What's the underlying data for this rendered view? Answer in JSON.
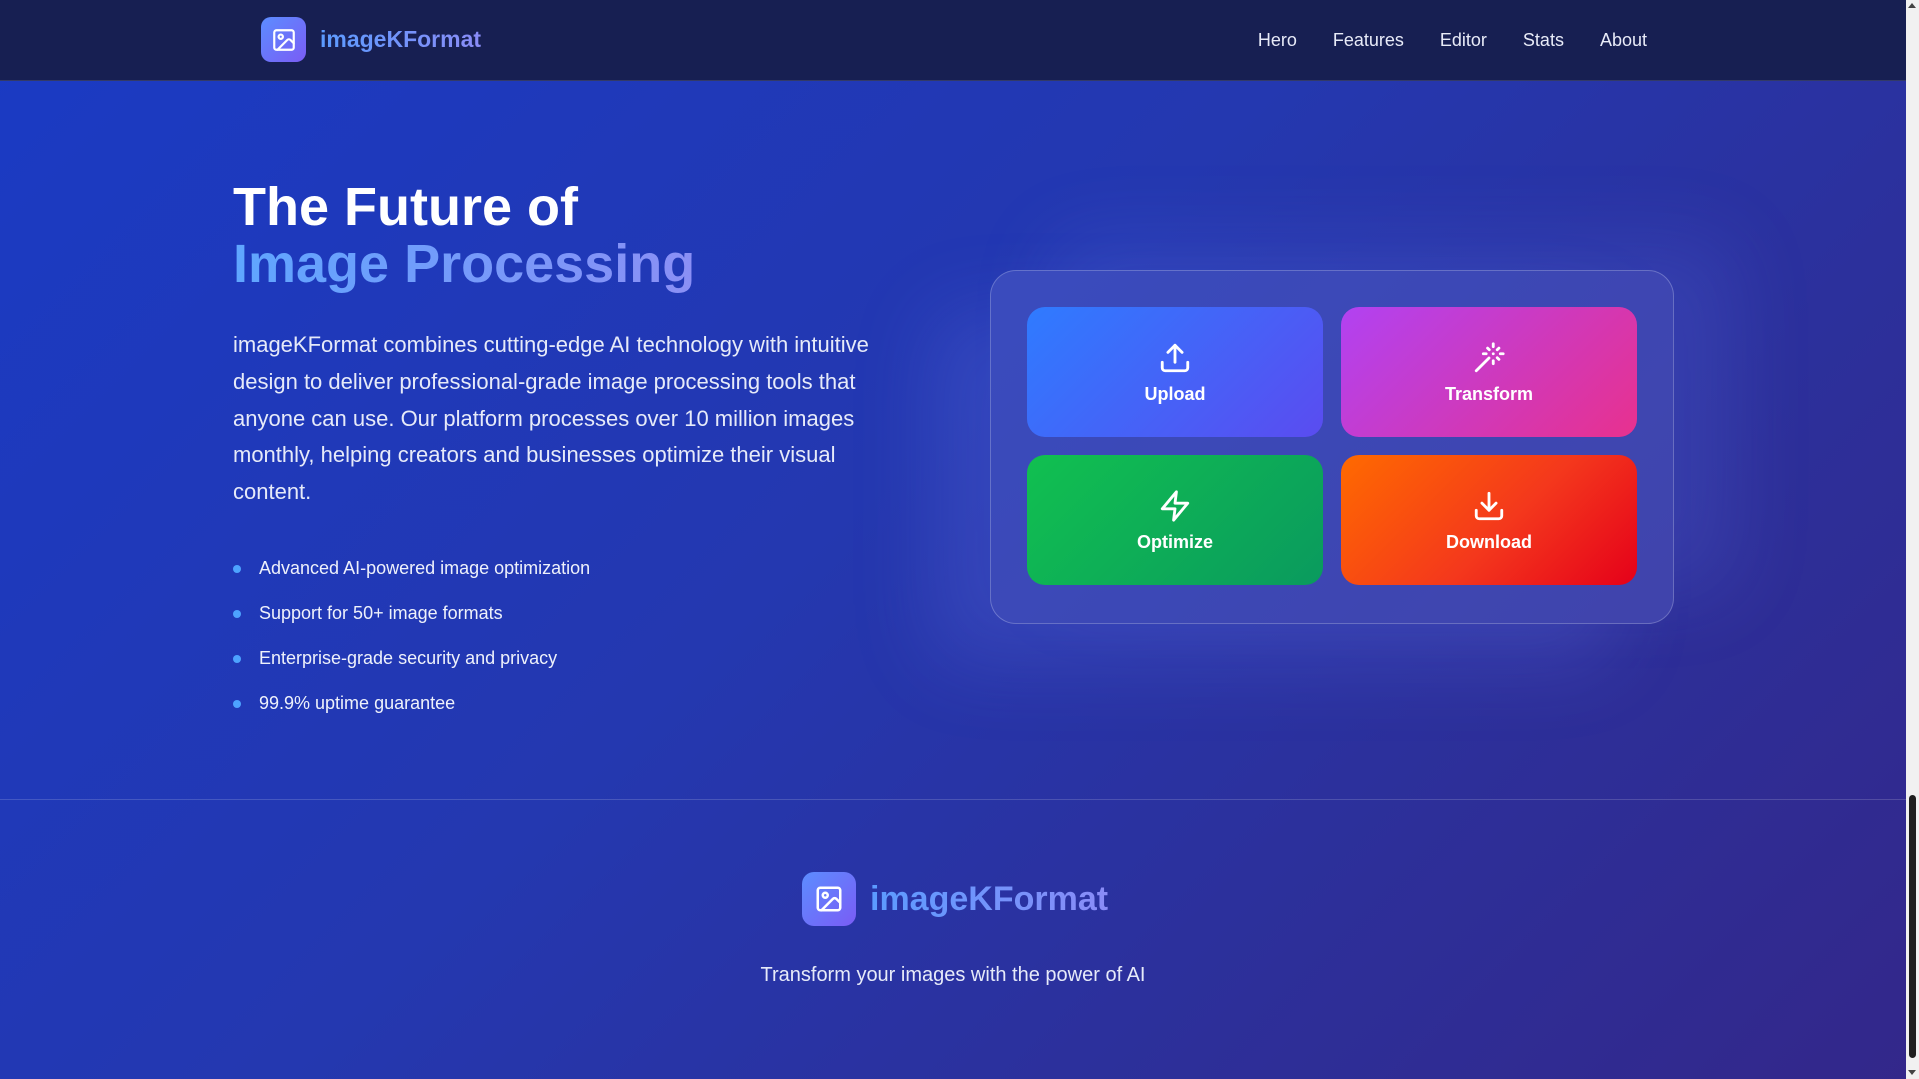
{
  "nav": {
    "brand": "imageKFormat",
    "links": [
      "Hero",
      "Features",
      "Editor",
      "Stats",
      "About"
    ]
  },
  "hero": {
    "title_line1": "The Future of",
    "title_line2": "Image Processing",
    "description": "imageKFormat combines cutting-edge AI technology with intuitive design to deliver professional-grade image processing tools that anyone can use. Our platform processes over 10 million images monthly, helping creators and businesses optimize their visual content.",
    "features": [
      "Advanced AI-powered image optimization",
      "Support for 50+ image formats",
      "Enterprise-grade security and privacy",
      "99.9% uptime guarantee"
    ]
  },
  "actions": [
    {
      "label": "Upload",
      "icon": "upload-icon",
      "color": "#3f6cf8"
    },
    {
      "label": "Transform",
      "icon": "magic-wand-icon",
      "color": "#cc3ac0"
    },
    {
      "label": "Optimize",
      "icon": "lightning-icon",
      "color": "#0db055"
    },
    {
      "label": "Download",
      "icon": "download-icon",
      "color": "#f4381c"
    }
  ],
  "footer": {
    "brand": "imageKFormat",
    "tagline": "Transform your images with the power of AI"
  },
  "colors": {
    "accent": "#5b9bff",
    "nav_bg": "#171f52",
    "page_bg": "#2438b0"
  }
}
